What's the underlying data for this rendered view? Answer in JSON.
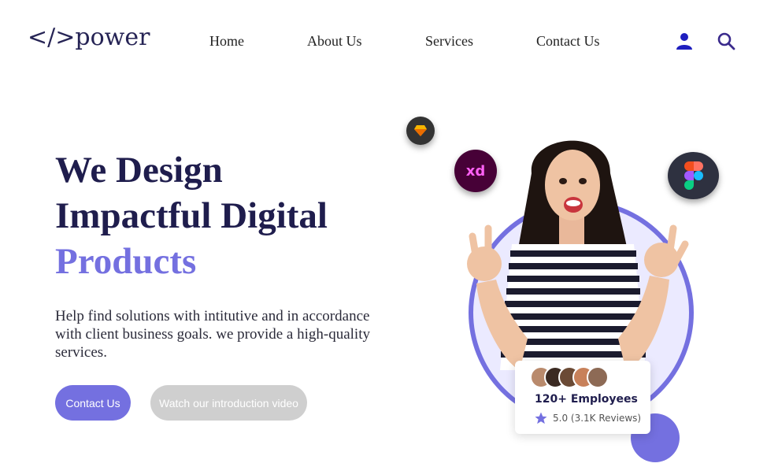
{
  "header": {
    "logo": "</>power",
    "nav": [
      "Home",
      "About Us",
      "Services",
      "Contact Us"
    ],
    "icons": [
      "user-icon",
      "search-icon"
    ]
  },
  "hero": {
    "title_line1": "We Design",
    "title_line2": "Impactful Digital",
    "title_accent": "Products",
    "description": "Help find solutions with intitutive and in accordance with client business goals. we provide a high-quality services.",
    "primary_button": "Contact Us",
    "secondary_button": "Watch our introduction video"
  },
  "visual": {
    "tool_icons": [
      "sketch-icon",
      "adobe-xd-icon",
      "figma-icon"
    ],
    "xd_label": "xd",
    "employees_card": {
      "title": "120+ Employees",
      "rating": "5.0 (3.1K Reviews)"
    }
  },
  "colors": {
    "accent": "#7470e0",
    "heading": "#1f1d4d",
    "button_secondary": "#cfcfcf"
  }
}
